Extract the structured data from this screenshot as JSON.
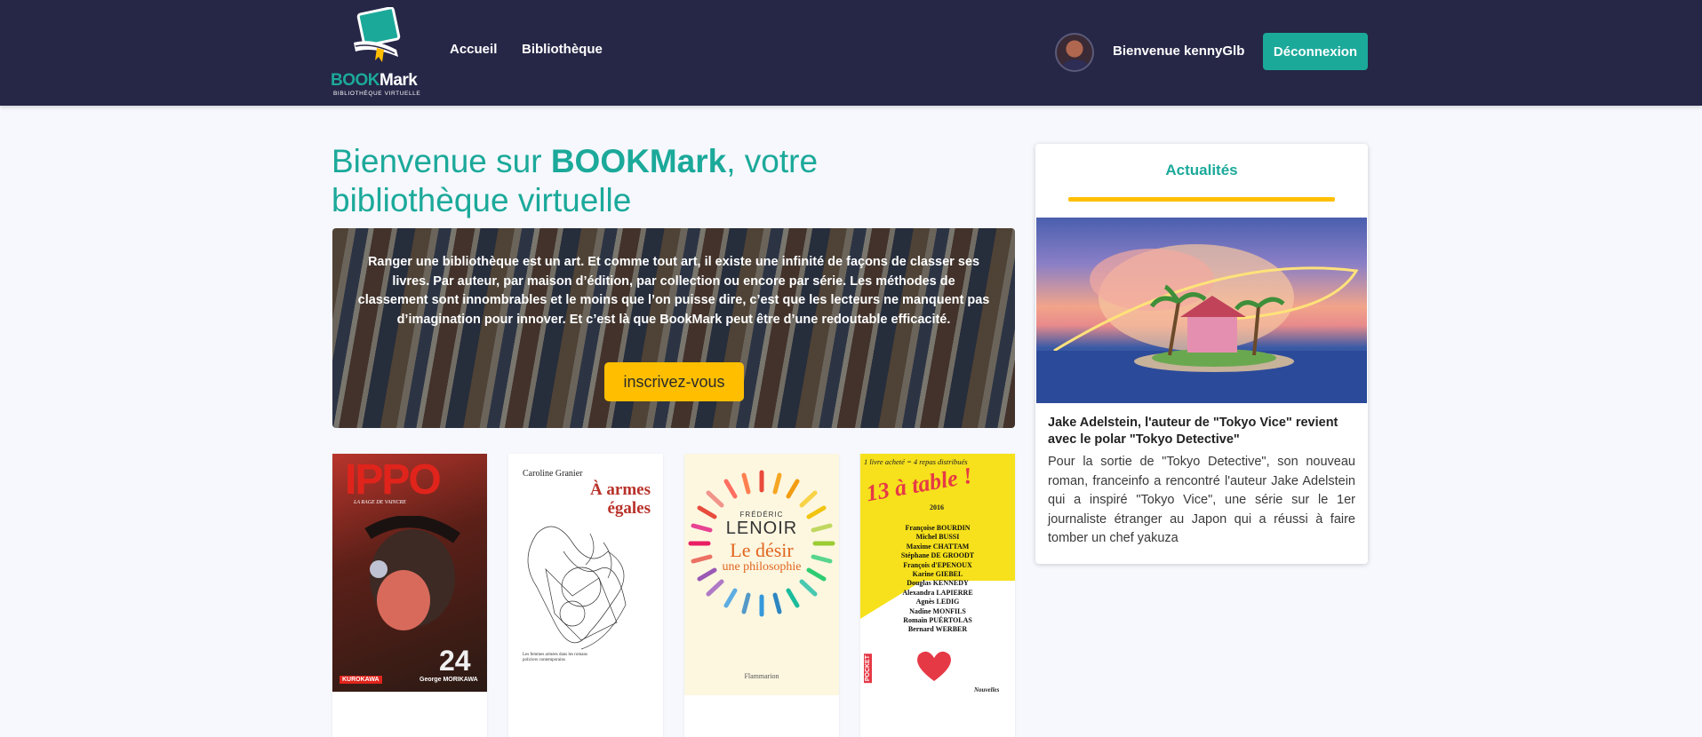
{
  "brand": {
    "name_part1": "BOOK",
    "name_part2": "Mark",
    "tagline": "BIBLIOTHÈQUE VIRTUELLE"
  },
  "nav": {
    "home": "Accueil",
    "library": "Bibliothèque"
  },
  "user": {
    "welcome": "Bienvenue kennyGlb",
    "logout": "Déconnexion"
  },
  "hero": {
    "title_prefix": "Bienvenue sur ",
    "title_brand": "BOOKMark",
    "title_suffix": ", votre bibliothèque virtuelle",
    "description": "Ranger une bibliothèque est un art. Et comme tout art, il existe une infinité de façons de classer ses livres. Par auteur, par maison d’édition, par collection ou encore par série. Les méthodes de classement sont innombrables et le moins que l’on puisse dire, c’est que les lecteurs ne manquent pas d’imagination pour innover. Et c’est là que BookMark peut être d’une redoutable efficacité.",
    "cta": "inscrivez-vous"
  },
  "books": [
    {
      "title": "IPPO",
      "subtitle": "LA RAGE DE VAINCRE",
      "author": "George MORIKAWA",
      "publisher": "KUROKAWA",
      "volume": "24"
    },
    {
      "title": "À armes égales",
      "author": "Caroline Granier",
      "footer": "Les femmes armées dans les romans policiers contemporains"
    },
    {
      "title": "Le désir",
      "subtitle": "une philosophie",
      "author_first": "FRÉDÉRIC",
      "author_last": "LENOIR",
      "publisher": "Flammarion"
    },
    {
      "title": "13 à table !",
      "top": "1 livre acheté = 4 repas distribués",
      "year": "2016",
      "authors": [
        "Françoise BOURDIN",
        "Michel BUSSI",
        "Maxime CHATTAM",
        "Stéphane DE GROODT",
        "François d'EPENOUX",
        "Karine GIEBEL",
        "Douglas KENNEDY",
        "Alexandra LAPIERRE",
        "Agnès LEDIG",
        "Nadine MONFILS",
        "Romain PUÉRTOLAS",
        "Bernard WERBER"
      ],
      "publisher": "POCKET",
      "genre": "Nouvelles"
    }
  ],
  "news": {
    "heading": "Actualités",
    "headline": "Jake Adelstein, l'auteur de \"Tokyo Vice\" revient avec le polar \"Tokyo Detective\"",
    "body": "Pour la sortie de \"Tokyo Detective\", son nouveau roman, franceinfo a rencontré l'auteur Jake Adelstein qui a inspiré \"Tokyo Vice\", une série sur le 1er journaliste étranger au Japon qui a réussi à faire tomber un chef yakuza"
  },
  "colors": {
    "navbar": "#262647",
    "accent": "#1ba99a",
    "cta": "#ffbf00",
    "background": "#f6f8fd"
  }
}
